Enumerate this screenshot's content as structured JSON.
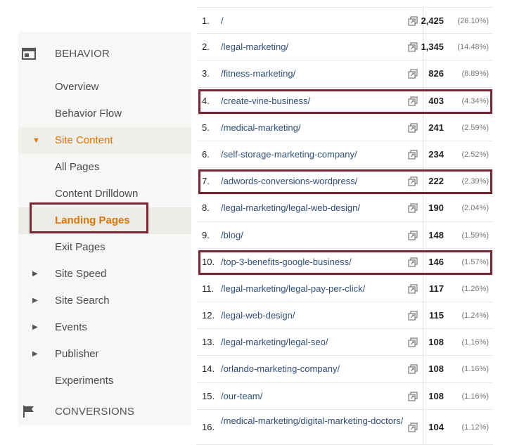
{
  "sidebar": {
    "behavior": {
      "label": "BEHAVIOR",
      "icon": "behavior-report-icon"
    },
    "items": [
      {
        "label": "Overview"
      },
      {
        "label": "Behavior Flow"
      },
      {
        "label": "Site Content",
        "expanded": true
      },
      {
        "label": "All Pages"
      },
      {
        "label": "Content Drilldown"
      },
      {
        "label": "Landing Pages",
        "active": true
      },
      {
        "label": "Exit Pages"
      },
      {
        "label": "Site Speed"
      },
      {
        "label": "Site Search"
      },
      {
        "label": "Events"
      },
      {
        "label": "Publisher"
      },
      {
        "label": "Experiments"
      }
    ],
    "conversions": {
      "label": "CONVERSIONS",
      "icon": "flag-icon"
    }
  },
  "table": {
    "rows": [
      {
        "num": "1.",
        "path": "/",
        "value": "2,425",
        "pct": "(26.10%)"
      },
      {
        "num": "2.",
        "path": "/legal-marketing/",
        "value": "1,345",
        "pct": "(14.48%)"
      },
      {
        "num": "3.",
        "path": "/fitness-marketing/",
        "value": "826",
        "pct": "(8.89%)"
      },
      {
        "num": "4.",
        "path": "/create-vine-business/",
        "value": "403",
        "pct": "(4.34%)",
        "highlighted": true
      },
      {
        "num": "5.",
        "path": "/medical-marketing/",
        "value": "241",
        "pct": "(2.59%)"
      },
      {
        "num": "6.",
        "path": "/self-storage-marketing-company/",
        "value": "234",
        "pct": "(2.52%)"
      },
      {
        "num": "7.",
        "path": "/adwords-conversions-wordpress/",
        "value": "222",
        "pct": "(2.39%)",
        "highlighted": true
      },
      {
        "num": "8.",
        "path": "/legal-marketing/legal-web-design/",
        "value": "190",
        "pct": "(2.04%)"
      },
      {
        "num": "9.",
        "path": "/blog/",
        "value": "148",
        "pct": "(1.59%)"
      },
      {
        "num": "10.",
        "path": "/top-3-benefits-google-business/",
        "value": "146",
        "pct": "(1.57%)",
        "highlighted": true
      },
      {
        "num": "11.",
        "path": "/legal-marketing/legal-pay-per-click/",
        "value": "117",
        "pct": "(1.26%)"
      },
      {
        "num": "12.",
        "path": "/legal-web-design/",
        "value": "115",
        "pct": "(1.24%)"
      },
      {
        "num": "13.",
        "path": "/legal-marketing/legal-seo/",
        "value": "108",
        "pct": "(1.16%)"
      },
      {
        "num": "14.",
        "path": "/orlando-marketing-company/",
        "value": "108",
        "pct": "(1.16%)"
      },
      {
        "num": "15.",
        "path": "/our-team/",
        "value": "108",
        "pct": "(1.16%)"
      },
      {
        "num": "16.",
        "path": "/medical-marketing/digital-marketing-doctors/",
        "value": "104",
        "pct": "(1.12%)"
      }
    ]
  },
  "colors": {
    "accent_orange": "#e37400",
    "highlight_box": "#7b2331",
    "link_blue": "#2d4f7c",
    "sidebar_bg": "#f7f7f5"
  }
}
